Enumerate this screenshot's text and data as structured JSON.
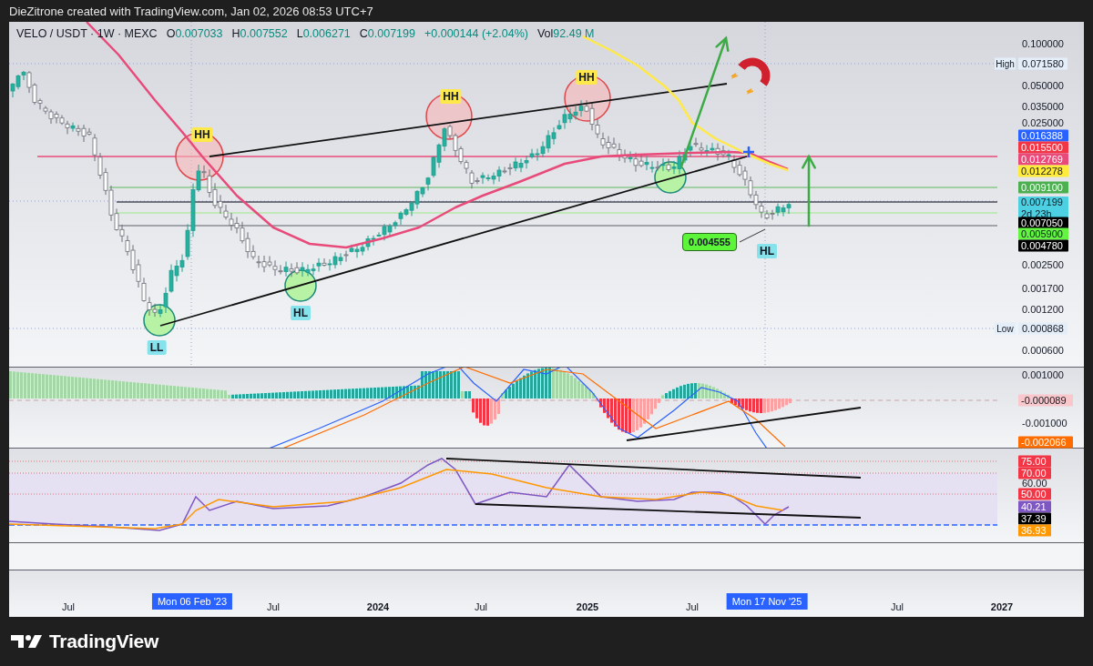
{
  "attribution": "DieZitrone created with TradingView.com, Jan 02, 2026 08:53 UTC+7",
  "legend": {
    "symbol": "VELO / USDT · 1W · MEXC",
    "items": [
      {
        "kind": "ohlc",
        "label": "O",
        "value": "0.007033"
      },
      {
        "kind": "ohlc",
        "label": "H",
        "value": "0.007552"
      },
      {
        "kind": "ohlc",
        "label": "L",
        "value": "0.006271"
      },
      {
        "kind": "ohlc",
        "label": "C",
        "value": "0.007199"
      },
      {
        "kind": "change",
        "value": "+0.000144 (+2.04%)"
      },
      {
        "kind": "ohlc",
        "label": "Vol",
        "value": "92.49 M"
      }
    ]
  },
  "markers": [
    {
      "text": "HH",
      "color": "#ffe94a"
    },
    {
      "text": "HH",
      "color": "#ffe94a"
    },
    {
      "text": "HH",
      "color": "#ffe94a"
    },
    {
      "text": "LL",
      "color": "#86e3ec"
    },
    {
      "text": "HL",
      "color": "#86e3ec"
    },
    {
      "text": "HL",
      "color": "#86e3ec"
    }
  ],
  "price_callout": {
    "text": "0.004555",
    "color": "#5cf53a"
  },
  "price_axis": {
    "labels": [
      {
        "kind": "tick",
        "text": "0.100000"
      },
      {
        "kind": "extreme",
        "name": "High",
        "text": "0.071580"
      },
      {
        "kind": "tick",
        "text": "0.050000"
      },
      {
        "kind": "tick",
        "text": "0.035000"
      },
      {
        "kind": "tick",
        "text": "0.025000"
      },
      {
        "kind": "tag",
        "text": "0.016388",
        "color": "#2962ff"
      },
      {
        "kind": "tag",
        "text": "0.015500",
        "color": "#f23645"
      },
      {
        "kind": "tag",
        "text": "0.012769",
        "color": "#e84a7a"
      },
      {
        "kind": "tag",
        "text": "0.012278",
        "color": "#ffeb3b"
      },
      {
        "kind": "tag",
        "text": "0.009100",
        "color": "#4caf50"
      },
      {
        "kind": "tag",
        "text": "0.007199",
        "countdown": "2d 23h",
        "color": "#4dd0e1"
      },
      {
        "kind": "tag",
        "text": "0.007050",
        "color": "#000000"
      },
      {
        "kind": "tag",
        "text": "0.005900",
        "color": "#64f542"
      },
      {
        "kind": "tag",
        "text": "0.004780",
        "color": "#000000"
      },
      {
        "kind": "tick",
        "text": "0.002500"
      },
      {
        "kind": "tick",
        "text": "0.001700"
      },
      {
        "kind": "tick",
        "text": "0.001200"
      },
      {
        "kind": "extreme",
        "name": "Low",
        "text": "0.000868"
      },
      {
        "kind": "tick",
        "text": "0.000600"
      }
    ]
  },
  "macd_axis": {
    "labels": [
      {
        "kind": "tick",
        "text": "0.001000"
      },
      {
        "kind": "tag",
        "text": "-0.000089",
        "color": "#f8c8cc"
      },
      {
        "kind": "tick",
        "text": "-0.001000"
      },
      {
        "kind": "tag",
        "text": "-0.002066",
        "color": "#ff6d00"
      }
    ]
  },
  "rsi_axis": {
    "labels": [
      {
        "kind": "tag",
        "text": "75.00",
        "color": "#f23645"
      },
      {
        "kind": "tag",
        "text": "70.00",
        "color": "#f23645"
      },
      {
        "kind": "tick",
        "text": "60.00"
      },
      {
        "kind": "tag",
        "text": "50.00",
        "color": "#f23645"
      },
      {
        "kind": "tag",
        "text": "40.21",
        "color": "#7e57c2"
      },
      {
        "kind": "tag",
        "text": "37.39",
        "color": "#000000"
      },
      {
        "kind": "tag",
        "text": "36.93",
        "color": "#ff9800"
      }
    ]
  },
  "time_axis": {
    "labels": [
      {
        "kind": "month",
        "text": "Jul"
      },
      {
        "kind": "cursor",
        "text": "Mon 06 Feb '23"
      },
      {
        "kind": "month",
        "text": "Jul"
      },
      {
        "kind": "year",
        "text": "2024"
      },
      {
        "kind": "month",
        "text": "Jul"
      },
      {
        "kind": "year",
        "text": "2025"
      },
      {
        "kind": "month",
        "text": "Jul"
      },
      {
        "kind": "cursor",
        "text": "Mon 17 Nov '25"
      },
      {
        "kind": "month",
        "text": "Jul"
      },
      {
        "kind": "year",
        "text": "2027"
      }
    ]
  },
  "footer": {
    "brand": "TradingView"
  }
}
